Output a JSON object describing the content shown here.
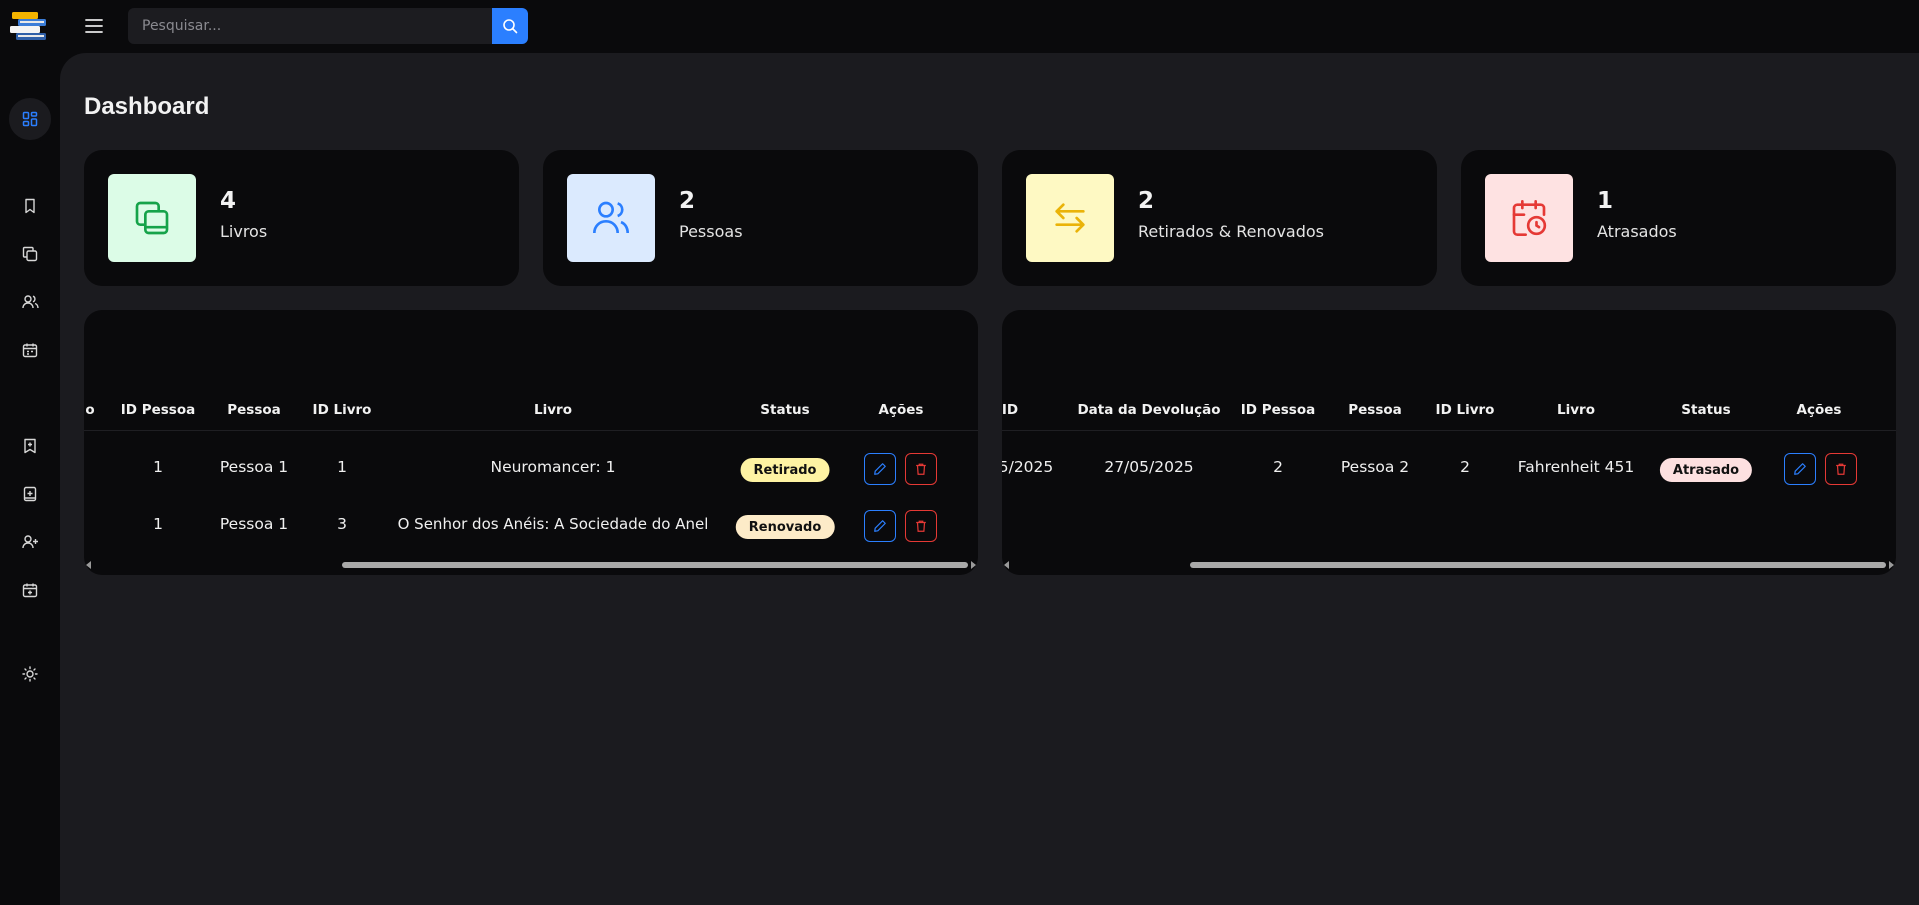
{
  "header": {
    "search_placeholder": "Pesquisar..."
  },
  "page": {
    "title": "Dashboard"
  },
  "stats": [
    {
      "value": "4",
      "label": "Livros",
      "icon": "books-copy-icon",
      "bg": "#dcfce7",
      "fg": "#16a34a"
    },
    {
      "value": "2",
      "label": "Pessoas",
      "icon": "users-icon",
      "bg": "#dbeafe",
      "fg": "#2b7fff"
    },
    {
      "value": "2",
      "label": "Retirados & Renovados",
      "icon": "arrows-exchange-icon",
      "bg": "#fef9c3",
      "fg": "#eab308"
    },
    {
      "value": "1",
      "label": "Atrasados",
      "icon": "calendar-clock-icon",
      "bg": "#fee2e2",
      "fg": "#e53935"
    }
  ],
  "loans_table": {
    "headers": [
      "o",
      "ID Pessoa",
      "Pessoa",
      "ID Livro",
      "Livro",
      "Status",
      "Ações"
    ],
    "rows": [
      {
        "id_pessoa": "1",
        "pessoa": "Pessoa 1",
        "id_livro": "1",
        "livro": "Neuromancer: 1",
        "status": "Retirado"
      },
      {
        "id_pessoa": "1",
        "pessoa": "Pessoa 1",
        "id_livro": "3",
        "livro": "O Senhor dos Anéis: A Sociedade do Anel",
        "status": "Renovado"
      }
    ]
  },
  "overdue_table": {
    "headers": [
      "ID",
      "Data da Devolução",
      "ID Pessoa",
      "Pessoa",
      "ID Livro",
      "Livro",
      "Status",
      "Ações"
    ],
    "rows": [
      {
        "date_partial": "5/2025",
        "data_devolucao": "27/05/2025",
        "id_pessoa": "2",
        "pessoa": "Pessoa 2",
        "id_livro": "2",
        "livro": "Fahrenheit 451",
        "status": "Atrasado"
      }
    ]
  },
  "status_colors": {
    "Retirado": "#fef3a3",
    "Renovado": "#fdebc8",
    "Atrasado": "#fde0e0"
  }
}
